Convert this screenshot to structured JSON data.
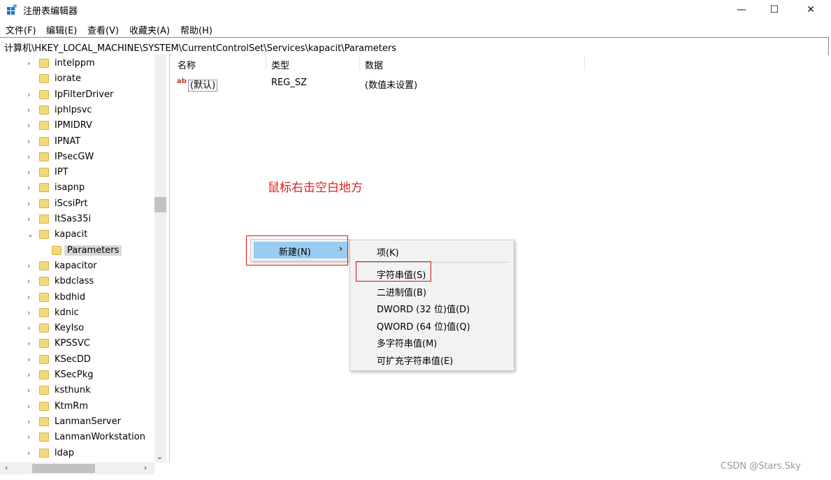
{
  "window": {
    "title": "注册表编辑器",
    "minimize_glyph": "—",
    "maximize_glyph": "☐",
    "close_glyph": "✕"
  },
  "menu": [
    "文件(F)",
    "编辑(E)",
    "查看(V)",
    "收藏夹(A)",
    "帮助(H)"
  ],
  "address": "计算机\\HKEY_LOCAL_MACHINE\\SYSTEM\\CurrentControlSet\\Services\\kapacit\\Parameters",
  "tree": [
    {
      "label": "intelppm",
      "expand": "›"
    },
    {
      "label": "iorate",
      "expand": ""
    },
    {
      "label": "IpFilterDriver",
      "expand": "›"
    },
    {
      "label": "iphlpsvc",
      "expand": "›"
    },
    {
      "label": "IPMIDRV",
      "expand": "›"
    },
    {
      "label": "IPNAT",
      "expand": "›"
    },
    {
      "label": "IPsecGW",
      "expand": "›"
    },
    {
      "label": "IPT",
      "expand": "›"
    },
    {
      "label": "isapnp",
      "expand": "›"
    },
    {
      "label": "iScsiPrt",
      "expand": "›"
    },
    {
      "label": "ItSas35i",
      "expand": "›"
    },
    {
      "label": "kapacit",
      "expand": "⌄"
    },
    {
      "label": "Parameters",
      "expand": "",
      "child": true,
      "selected": true
    },
    {
      "label": "kapacitor",
      "expand": "›"
    },
    {
      "label": "kbdclass",
      "expand": "›"
    },
    {
      "label": "kbdhid",
      "expand": "›"
    },
    {
      "label": "kdnic",
      "expand": "›"
    },
    {
      "label": "KeyIso",
      "expand": "›"
    },
    {
      "label": "KPSSVC",
      "expand": "›"
    },
    {
      "label": "KSecDD",
      "expand": "›"
    },
    {
      "label": "KSecPkg",
      "expand": "›"
    },
    {
      "label": "ksthunk",
      "expand": "›"
    },
    {
      "label": "KtmRm",
      "expand": "›"
    },
    {
      "label": "LanmanServer",
      "expand": "›"
    },
    {
      "label": "LanmanWorkstation",
      "expand": "›"
    },
    {
      "label": "ldap",
      "expand": "›"
    }
  ],
  "columns": {
    "name": "名称",
    "type": "类型",
    "data": "数据"
  },
  "values": [
    {
      "icon": "ab",
      "name": "(默认)",
      "type": "REG_SZ",
      "data": "(数值未设置)"
    }
  ],
  "annotation": "鼠标右击空白地方",
  "context_menu": {
    "new_item": "新建(N)",
    "submenu_arrow": "›",
    "submenu": [
      "项(K)",
      "字符串值(S)",
      "二进制值(B)",
      "DWORD (32 位)值(D)",
      "QWORD (64 位)值(Q)",
      "多字符串值(M)",
      "可扩充字符串值(E)"
    ]
  },
  "scroll": {
    "up": "",
    "down": "⌄",
    "left": "‹",
    "right": "›"
  },
  "watermark": "CSDN @Stars.Sky"
}
